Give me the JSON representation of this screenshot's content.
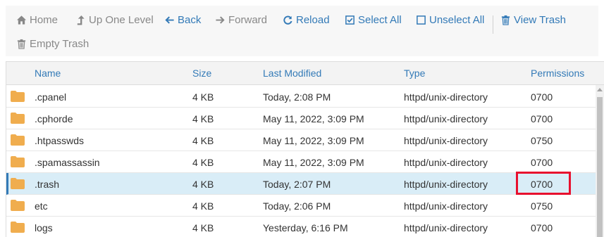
{
  "toolbar": {
    "home_label": "Home",
    "up_label": "Up One Level",
    "back_label": "Back",
    "forward_label": "Forward",
    "reload_label": "Reload",
    "select_all_label": "Select All",
    "unselect_all_label": "Unselect All",
    "view_trash_label": "View Trash",
    "empty_trash_label": "Empty Trash"
  },
  "table": {
    "headers": {
      "name": "Name",
      "size": "Size",
      "modified": "Last Modified",
      "type": "Type",
      "permissions": "Permissions"
    },
    "rows": [
      {
        "name": ".cpanel",
        "size": "4 KB",
        "modified": "Today, 2:08 PM",
        "type": "httpd/unix-directory",
        "permissions": "0700"
      },
      {
        "name": ".cphorde",
        "size": "4 KB",
        "modified": "May 11, 2022, 3:09 PM",
        "type": "httpd/unix-directory",
        "permissions": "0700"
      },
      {
        "name": ".htpasswds",
        "size": "4 KB",
        "modified": "May 11, 2022, 3:09 PM",
        "type": "httpd/unix-directory",
        "permissions": "0750"
      },
      {
        "name": ".spamassassin",
        "size": "4 KB",
        "modified": "May 11, 2022, 3:09 PM",
        "type": "httpd/unix-directory",
        "permissions": "0700"
      },
      {
        "name": ".trash",
        "size": "4 KB",
        "modified": "Today, 2:07 PM",
        "type": "httpd/unix-directory",
        "permissions": "0700"
      },
      {
        "name": "etc",
        "size": "4 KB",
        "modified": "Today, 2:06 PM",
        "type": "httpd/unix-directory",
        "permissions": "0750"
      },
      {
        "name": "logs",
        "size": "4 KB",
        "modified": "Yesterday, 6:16 PM",
        "type": "httpd/unix-directory",
        "permissions": "0700"
      }
    ],
    "selected_row": 4
  },
  "colors": {
    "link": "#337ab7",
    "folder": "#f0ad4e",
    "selected_row": "#d9edf7",
    "highlight": "#e8102e"
  },
  "icons": {
    "home": "home-icon",
    "up": "level-up-icon",
    "back": "arrow-left-icon",
    "forward": "arrow-right-icon",
    "reload": "refresh-icon",
    "select_all": "checkbox-checked-icon",
    "unselect_all": "checkbox-empty-icon",
    "trash": "trash-icon",
    "folder": "folder-icon"
  }
}
